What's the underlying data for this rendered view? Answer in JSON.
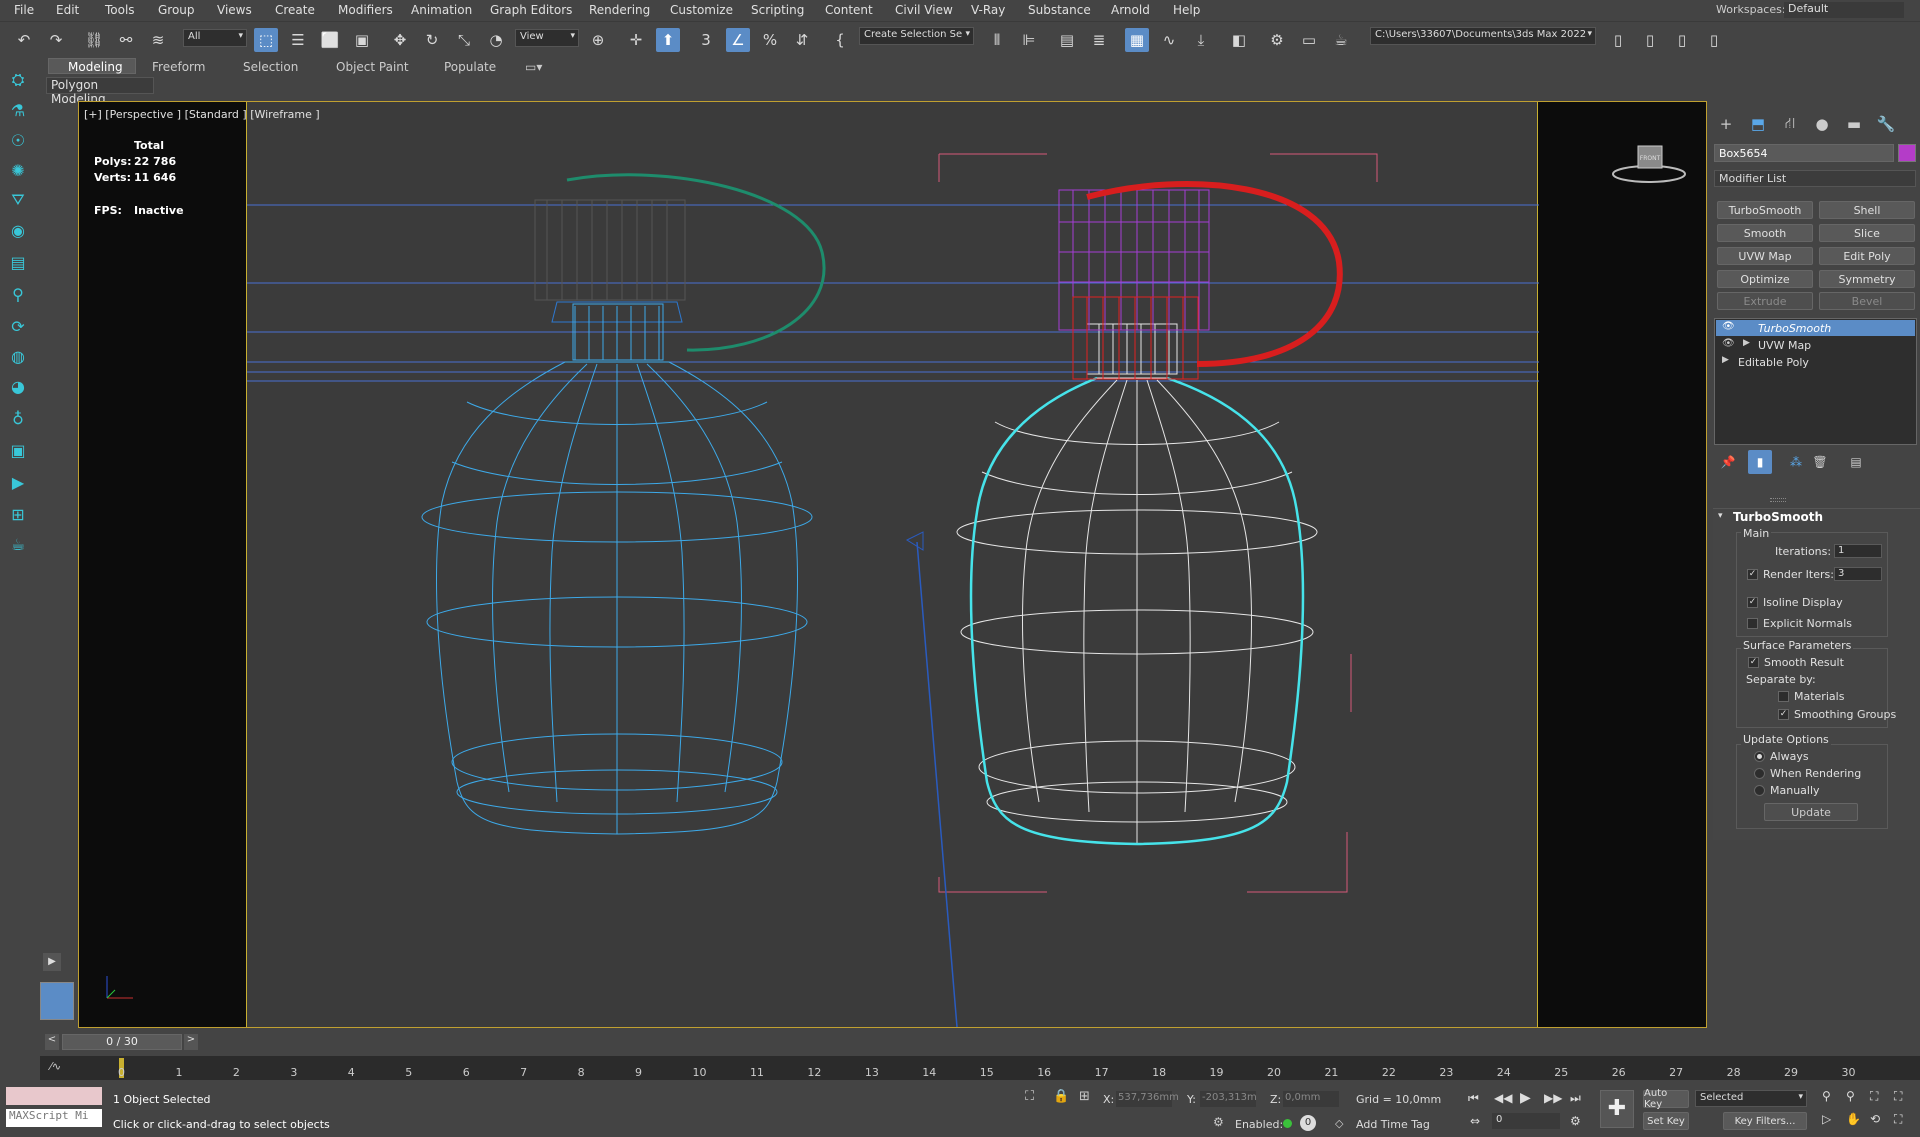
{
  "menu": [
    "File",
    "Edit",
    "Tools",
    "Group",
    "Views",
    "Create",
    "Modifiers",
    "Animation",
    "Graph Editors",
    "Rendering",
    "Customize",
    "Scripting",
    "Content",
    "Civil View",
    "V-Ray",
    "Substance",
    "Arnold",
    "Help"
  ],
  "workspaces": {
    "label": "Workspaces:",
    "value": "Default"
  },
  "toolbar": {
    "selection_filter": "All",
    "ref_coord": "View",
    "named_selection": "Create Selection Se",
    "project_path": "C:\\Users\\33607\\Documents\\3ds Max 2022"
  },
  "ribbon": {
    "tabs": [
      "Modeling",
      "Freeform",
      "Selection",
      "Object Paint",
      "Populate"
    ],
    "sub": "Polygon Modeling"
  },
  "viewport": {
    "label": "[+] [Perspective ] [Standard ] [Wireframe ]",
    "stats": {
      "header": "Total",
      "polys_label": "Polys:",
      "polys": "22 786",
      "verts_label": "Verts:",
      "verts": "11 646",
      "fps_label": "FPS:",
      "fps": "Inactive"
    },
    "viewcube": "FRONT"
  },
  "panel": {
    "object_name": "Box5654",
    "object_color": "#b43cc8",
    "modifier_list": "Modifier List",
    "modifier_buttons": [
      [
        "TurboSmooth",
        "Shell"
      ],
      [
        "Smooth",
        "Slice"
      ],
      [
        "UVW Map",
        "Edit Poly"
      ],
      [
        "Optimize",
        "Symmetry"
      ],
      [
        "Extrude",
        "Bevel"
      ]
    ],
    "stack": [
      "TurboSmooth",
      "UVW Map",
      "Editable Poly"
    ],
    "rollout": {
      "title": "TurboSmooth",
      "main": "Main",
      "iterations_label": "Iterations:",
      "iterations": "1",
      "render_iters_label": "Render Iters:",
      "render_iters": "3",
      "isoline": "Isoline Display",
      "explicit_normals": "Explicit Normals",
      "surface_params": "Surface Parameters",
      "smooth_result": "Smooth Result",
      "separate_by": "Separate by:",
      "materials": "Materials",
      "smoothing_groups": "Smoothing Groups",
      "update_options": "Update Options",
      "always": "Always",
      "when_rendering": "When Rendering",
      "manually": "Manually",
      "update": "Update"
    }
  },
  "timeline": {
    "frame": "0 / 30",
    "ticks": [
      "0",
      "1",
      "2",
      "3",
      "4",
      "5",
      "6",
      "7",
      "8",
      "9",
      "10",
      "11",
      "12",
      "13",
      "14",
      "15",
      "16",
      "17",
      "18",
      "19",
      "20",
      "21",
      "22",
      "23",
      "24",
      "25",
      "26",
      "27",
      "28",
      "29",
      "30"
    ]
  },
  "status": {
    "maxscript": "MAXScript Mi",
    "selected": "1 Object Selected",
    "hint": "Click or click-and-drag to select objects",
    "x_label": "X:",
    "x": "537,736mm",
    "y_label": "Y:",
    "y": "-203,313m",
    "z_label": "Z:",
    "z": "0,0mm",
    "grid": "Grid = 10,0mm",
    "enabled": "Enabled:",
    "add_time_tag": "Add Time Tag",
    "auto_key": "Auto Key",
    "set_key": "Set Key",
    "selected_dd": "Selected",
    "key_filters": "Key Filters...",
    "frame_field": "0"
  }
}
